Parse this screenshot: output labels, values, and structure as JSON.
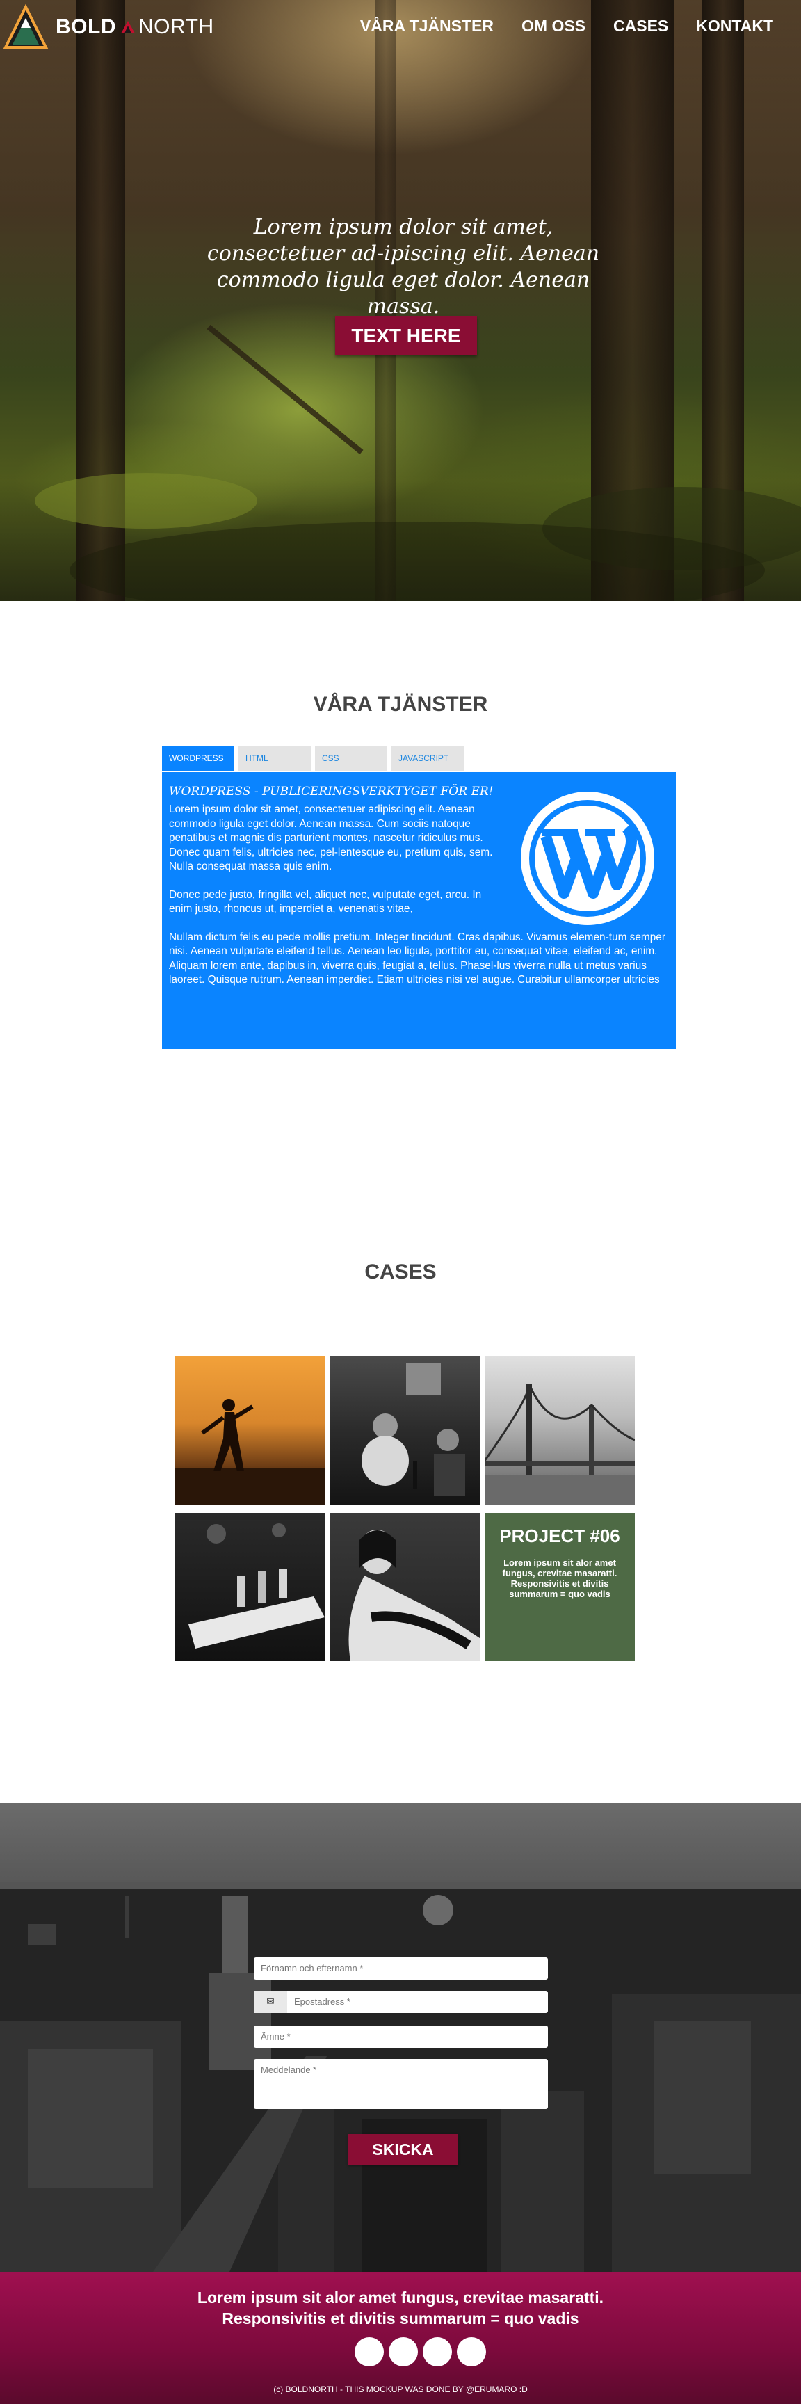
{
  "brand": {
    "name_bold": "BOLD",
    "name_light": "NORTH"
  },
  "nav": {
    "items": [
      "VÅRA TJÄNSTER",
      "OM OSS",
      "CASES",
      "KONTAKT"
    ]
  },
  "hero": {
    "text": "Lorem ipsum dolor sit amet, consectetuer ad-ipiscing elit. Aenean commodo ligula eget dolor. Aenean massa.",
    "button_label": "TEXT HERE"
  },
  "services": {
    "title": "VÅRA TJÄNSTER",
    "tabs": [
      "WORDPRESS",
      "HTML",
      "CSS",
      "JAVASCRIPT"
    ],
    "active_tab": "WORDPRESS",
    "panel": {
      "heading": "WORDPRESS - PUBLICERINGSVERKTYGET FÖR ER!",
      "paragraph1": "Lorem ipsum dolor sit amet, consectetuer adipiscing elit. Aenean commodo ligula eget dolor. Aenean massa. Cum sociis natoque penatibus et magnis dis parturient montes, nascetur ridiculus mus. Donec quam felis, ultricies nec, pel-lentesque eu, pretium quis, sem. Nulla consequat massa quis enim.",
      "paragraph2": "Donec pede justo, fringilla vel, aliquet nec, vulputate eget, arcu. In enim justo, rhoncus ut, imperdiet a, venenatis vitae,",
      "paragraph3": "Nullam dictum felis eu pede mollis pretium. Integer tincidunt. Cras dapibus. Vivamus elemen-tum semper nisi. Aenean vulputate eleifend tellus. Aenean leo ligula, porttitor eu, consequat vitae, eleifend ac, enim. Aliquam lorem ante, dapibus in, viverra quis, feugiat a, tellus. Phasel-lus viverra nulla ut metus varius laoreet. Quisque rutrum. Aenean imperdiet. Etiam ultricies nisi vel augue. Curabitur ullamcorper ultricies"
    },
    "icon": "wordpress-logo-icon",
    "colors": {
      "panel": "#0a84ff",
      "tab_inactive": "#e4e4e4"
    }
  },
  "cases": {
    "title": "CASES",
    "project": {
      "title": "PROJECT #06",
      "description": "Lorem ipsum sit alor amet fungus, crevitae masaratti. Responsivitis et divitis summarum = quo vadis"
    }
  },
  "contact": {
    "name_placeholder": "Förnamn och efternamn *",
    "email_placeholder": "Epostadress *",
    "subject_placeholder": "Ämne *",
    "message_placeholder": "Meddelande *",
    "send_label": "SKICKA",
    "mail_icon": "✉"
  },
  "footer": {
    "line1": "Lorem ipsum sit alor amet fungus, crevitae masaratti.",
    "line2": "Responsivitis et divitis summarum = quo vadis",
    "credit": "(c) BOLDNORTH - THIS MOCKUP WAS DONE BY @ERUMARO :D",
    "social_icons": [
      "social-icon",
      "social-icon",
      "social-icon",
      "social-icon"
    ]
  },
  "colors": {
    "accent": "#8a0d34",
    "footer": "#8c0c45",
    "project_tile": "#4e6a45"
  }
}
